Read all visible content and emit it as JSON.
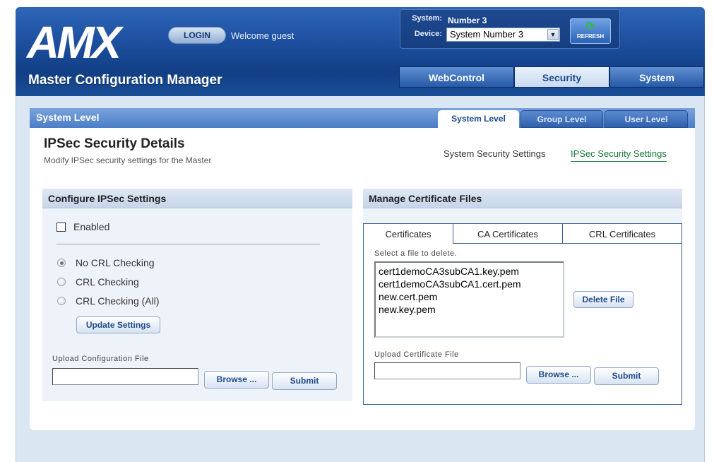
{
  "header": {
    "login_label": "LOGIN",
    "welcome_text": "Welcome guest",
    "system_label": "System:",
    "system_value": "Number 3",
    "device_label": "Device:",
    "device_selected": "System Number 3",
    "refresh_label": "REFRESH",
    "app_title": "Master Configuration Manager",
    "nav_tabs": [
      {
        "label": "WebControl"
      },
      {
        "label": "Security"
      },
      {
        "label": "System"
      }
    ]
  },
  "level": {
    "title": "System Level",
    "tabs": [
      {
        "label": "System Level"
      },
      {
        "label": "Group Level"
      },
      {
        "label": "User Level"
      }
    ]
  },
  "page": {
    "title": "IPSec Security Details",
    "subtitle": "Modify IPSec security settings for the Master",
    "link_system_security": "System Security Settings",
    "link_ipsec_security": "IPSec Security Settings"
  },
  "configure": {
    "heading": "Configure IPSec Settings",
    "enabled_label": "Enabled",
    "radios": [
      {
        "label": "No CRL Checking",
        "checked": true
      },
      {
        "label": "CRL Checking",
        "checked": false
      },
      {
        "label": "CRL Checking (All)",
        "checked": false
      }
    ],
    "update_button": "Update Settings",
    "upload_label": "Upload Configuration File",
    "browse_button": "Browse ...",
    "submit_button": "Submit"
  },
  "certificates": {
    "heading": "Manage Certificate Files",
    "tabs": [
      {
        "label": "Certificates"
      },
      {
        "label": "CA Certificates"
      },
      {
        "label": "CRL Certificates"
      }
    ],
    "select_label": "Select a file to delete.",
    "files": [
      "cert1demoCA3subCA1.key.pem",
      "cert1demoCA3subCA1.cert.pem",
      "new.cert.pem",
      "new.key.pem"
    ],
    "delete_button": "Delete File",
    "upload_label": "Upload Certificate File",
    "browse_button": "Browse ...",
    "submit_button": "Submit"
  },
  "brand": {
    "logo_text": "AMX"
  }
}
